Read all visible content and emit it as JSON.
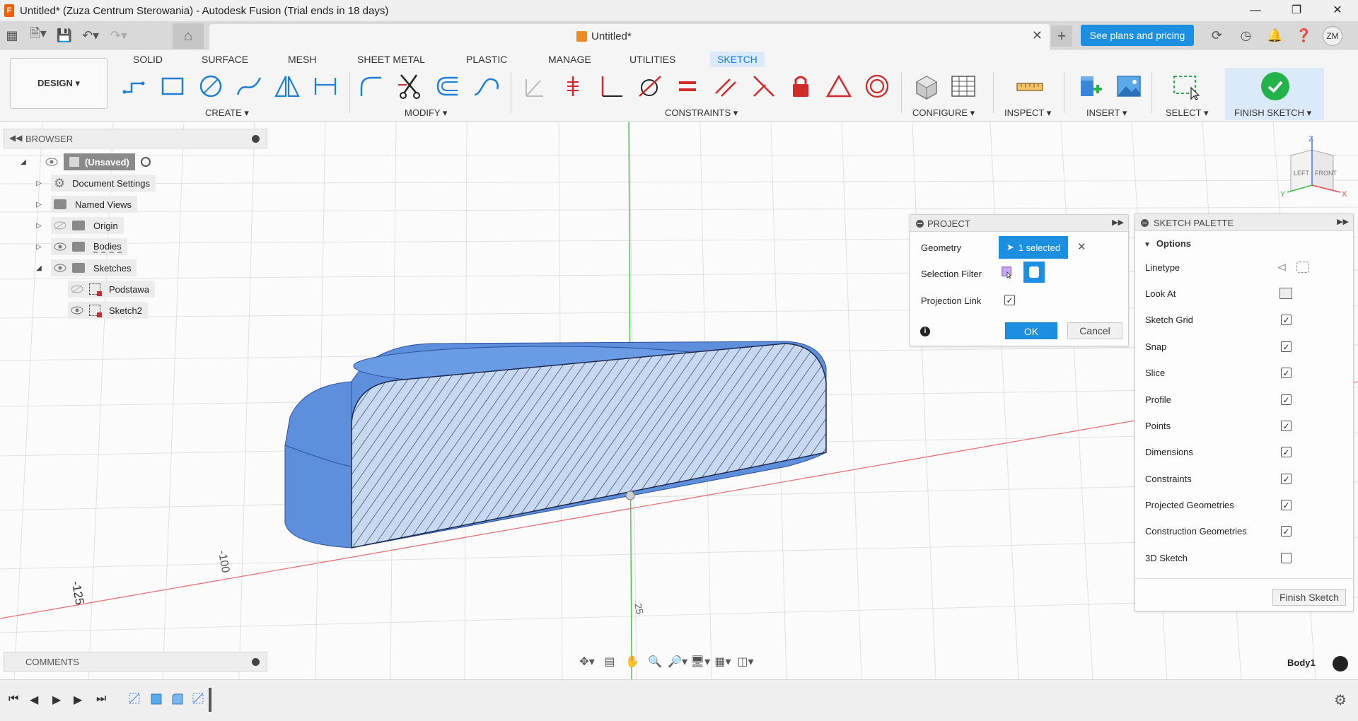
{
  "window": {
    "title": "Untitled* (Zuza Centrum Sterowania) - Autodesk Fusion (Trial ends in 18 days)",
    "app_icon_letter": "F",
    "minimize": "—",
    "maximize": "❐",
    "close": "✕"
  },
  "tabbar": {
    "document_title": "Untitled*",
    "close_glyph": "✕",
    "new_tab_glyph": "+",
    "plans_button": "See plans and pricing",
    "user_initials": "ZM"
  },
  "toolbar": {
    "design_label": "DESIGN ▾",
    "tabs": [
      "SOLID",
      "SURFACE",
      "MESH",
      "SHEET METAL",
      "PLASTIC",
      "MANAGE",
      "UTILITIES",
      "SKETCH"
    ],
    "active_tab": "SKETCH",
    "groups": {
      "create": "CREATE ▾",
      "modify": "MODIFY ▾",
      "constraints": "CONSTRAINTS ▾",
      "configure": "CONFIGURE ▾",
      "inspect": "INSPECT ▾",
      "insert": "INSERT ▾",
      "select": "SELECT ▾",
      "finish_sketch": "FINISH SKETCH ▾"
    },
    "accent_color": "#1d8fe1",
    "constraint_color": "#d12a2a"
  },
  "browser": {
    "header": "BROWSER",
    "items": [
      {
        "label": "(Unsaved)",
        "level": 0
      },
      {
        "label": "Document Settings",
        "level": 1
      },
      {
        "label": "Named Views",
        "level": 1
      },
      {
        "label": "Origin",
        "level": 1
      },
      {
        "label": "Bodies",
        "level": 1
      },
      {
        "label": "Sketches",
        "level": 1
      },
      {
        "label": "Podstawa",
        "level": 2
      },
      {
        "label": "Sketch2",
        "level": 2
      }
    ]
  },
  "project_dialog": {
    "title": "PROJECT",
    "geometry_label": "Geometry",
    "geometry_value": "1 selected",
    "selection_filter_label": "Selection Filter",
    "projection_link_label": "Projection Link",
    "projection_link_checked": true,
    "ok": "OK",
    "cancel": "Cancel"
  },
  "sketch_palette": {
    "title": "SKETCH PALETTE",
    "section": "Options",
    "rows": [
      {
        "label": "Linetype",
        "kind": "icons"
      },
      {
        "label": "Look At",
        "kind": "icon"
      },
      {
        "label": "Sketch Grid",
        "checked": true
      },
      {
        "label": "Snap",
        "checked": true
      },
      {
        "label": "Slice",
        "checked": true
      },
      {
        "label": "Profile",
        "checked": true
      },
      {
        "label": "Points",
        "checked": true
      },
      {
        "label": "Dimensions",
        "checked": true
      },
      {
        "label": "Constraints",
        "checked": true
      },
      {
        "label": "Projected Geometries",
        "checked": true
      },
      {
        "label": "Construction Geometries",
        "checked": true
      },
      {
        "label": "3D Sketch",
        "checked": false
      }
    ],
    "finish_button": "Finish Sketch"
  },
  "canvas": {
    "axis_labels": [
      "-125",
      "-100",
      "25"
    ],
    "viewcube": {
      "left": "LEFT",
      "front": "FRONT",
      "z": "Z",
      "x": "X",
      "y": "Y"
    }
  },
  "comments": {
    "label": "COMMENTS"
  },
  "status": {
    "body_name": "Body1"
  }
}
